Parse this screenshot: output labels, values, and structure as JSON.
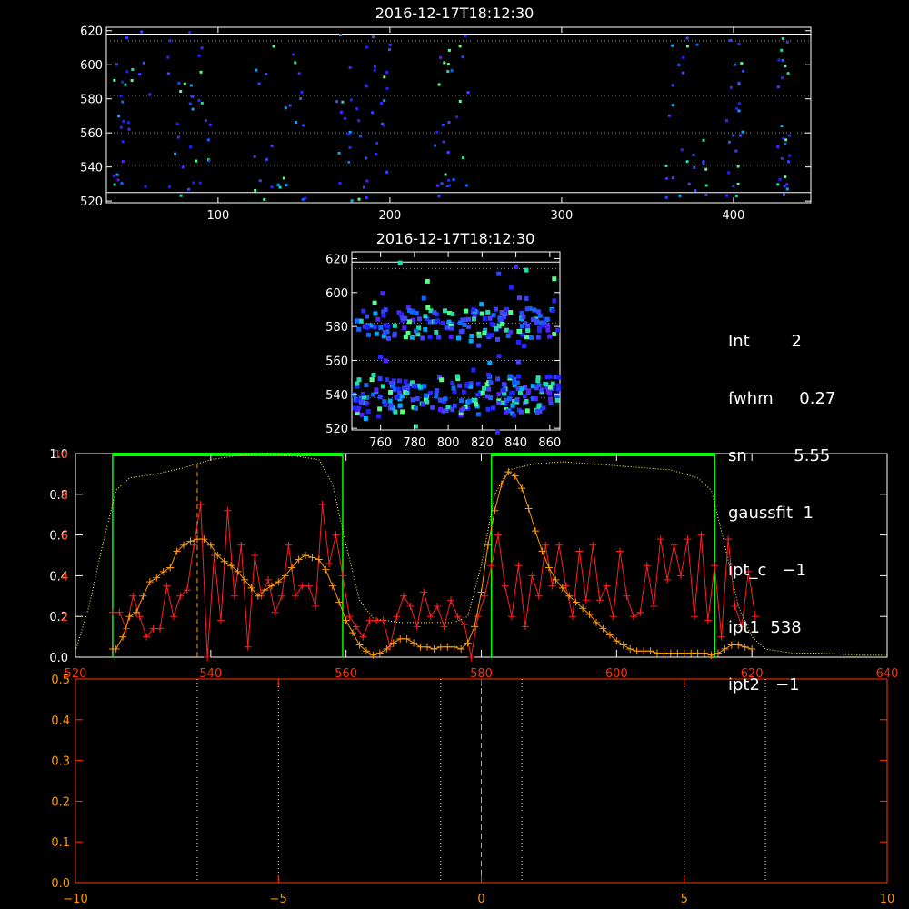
{
  "chart_data": [
    {
      "id": "top_image",
      "type": "heatmap",
      "title": "2016-12-17T18:12:30",
      "xlim": [
        35,
        445
      ],
      "ylim": [
        519,
        622
      ],
      "xticks": [
        100,
        200,
        300,
        400
      ],
      "yticks": [
        520,
        540,
        560,
        580,
        600,
        620
      ],
      "ref_lines_white": [
        525,
        618
      ],
      "ref_lines_green": [
        582,
        614,
        560
      ],
      "ref_lines_red": [
        541
      ],
      "columns": [
        [
          35,
          60
        ],
        [
          70,
          95
        ],
        [
          120,
          150
        ],
        [
          168,
          200
        ],
        [
          225,
          245
        ],
        [
          360,
          385
        ],
        [
          395,
          405
        ],
        [
          425,
          432
        ]
      ],
      "pixel_count": 230
    },
    {
      "id": "zoom_image",
      "type": "heatmap",
      "title": "2016-12-17T18:12:30",
      "xlim": [
        743,
        866
      ],
      "ylim": [
        519,
        624
      ],
      "xticks": [
        760,
        780,
        800,
        820,
        840,
        860
      ],
      "yticks": [
        520,
        540,
        560,
        580,
        600,
        620
      ],
      "ref_lines_white": [
        618
      ],
      "ref_lines_green": [
        614,
        582,
        560
      ],
      "ref_lines_red": [
        538
      ],
      "pixel_count": 420
    },
    {
      "id": "spectrum",
      "type": "line",
      "xlim": [
        520,
        640
      ],
      "ylim": [
        0,
        1.0
      ],
      "xticks": [
        520,
        540,
        560,
        580,
        600,
        620,
        640
      ],
      "yticks": [
        0.0,
        0.2,
        0.4,
        0.6,
        0.8,
        1.0
      ],
      "right_yticks": [
        2,
        4,
        6,
        8,
        10
      ],
      "windows": [
        [
          525.5,
          559.5
        ],
        [
          581.5,
          614.5
        ]
      ],
      "vline_orange": 538,
      "green_dotted": {
        "x": [
          520,
          522,
          524,
          526,
          528,
          532,
          536,
          540,
          544,
          548,
          552,
          556,
          558,
          560,
          562,
          564,
          568,
          572,
          576,
          578,
          580,
          582,
          584,
          588,
          592,
          596,
          600,
          604,
          608,
          612,
          614,
          616,
          618,
          620,
          622,
          626,
          630,
          636,
          640
        ],
        "y": [
          0.03,
          0.25,
          0.55,
          0.82,
          0.88,
          0.9,
          0.93,
          0.97,
          0.99,
          1.0,
          0.99,
          0.97,
          0.85,
          0.55,
          0.28,
          0.19,
          0.17,
          0.17,
          0.17,
          0.2,
          0.45,
          0.8,
          0.92,
          0.95,
          0.96,
          0.95,
          0.94,
          0.93,
          0.92,
          0.88,
          0.82,
          0.55,
          0.25,
          0.1,
          0.04,
          0.02,
          0.02,
          0.01,
          0.01
        ]
      },
      "orange_series": {
        "x": [
          525.5,
          526,
          527,
          528,
          529,
          530,
          531,
          532,
          533,
          534,
          535,
          536,
          537,
          538,
          539,
          540,
          541,
          542,
          543,
          544,
          545,
          546,
          547,
          548,
          549,
          550,
          551,
          552,
          553,
          554,
          555,
          556,
          557,
          558,
          559,
          560,
          561,
          562,
          563,
          564,
          565,
          566,
          567,
          568,
          569,
          570,
          571,
          572,
          573,
          574,
          575,
          576,
          577,
          578,
          579,
          580,
          581,
          582,
          583,
          584,
          585,
          586,
          587,
          588,
          589,
          590,
          591,
          592,
          593,
          594,
          595,
          596,
          597,
          598,
          599,
          600,
          601,
          602,
          603,
          604,
          605,
          606,
          607,
          608,
          609,
          610,
          611,
          612,
          613,
          614,
          615,
          616,
          617,
          618,
          619,
          620
        ],
        "y": [
          0.04,
          0.04,
          0.1,
          0.2,
          0.22,
          0.3,
          0.37,
          0.39,
          0.42,
          0.44,
          0.52,
          0.55,
          0.57,
          0.58,
          0.58,
          0.55,
          0.5,
          0.47,
          0.45,
          0.42,
          0.38,
          0.34,
          0.3,
          0.33,
          0.35,
          0.37,
          0.4,
          0.44,
          0.48,
          0.5,
          0.49,
          0.48,
          0.43,
          0.35,
          0.27,
          0.18,
          0.12,
          0.06,
          0.03,
          0.01,
          0.02,
          0.04,
          0.07,
          0.09,
          0.09,
          0.07,
          0.05,
          0.05,
          0.04,
          0.05,
          0.05,
          0.05,
          0.04,
          0.07,
          0.15,
          0.32,
          0.55,
          0.72,
          0.85,
          0.91,
          0.89,
          0.83,
          0.73,
          0.62,
          0.52,
          0.44,
          0.38,
          0.34,
          0.3,
          0.27,
          0.24,
          0.21,
          0.17,
          0.14,
          0.11,
          0.08,
          0.06,
          0.04,
          0.03,
          0.03,
          0.03,
          0.02,
          0.02,
          0.02,
          0.02,
          0.02,
          0.02,
          0.02,
          0.02,
          0.01,
          0.02,
          0.04,
          0.06,
          0.06,
          0.05,
          0.04
        ]
      },
      "red_series": {
        "x": [
          525.5,
          526.5,
          527.5,
          528.5,
          529.5,
          530.5,
          531.5,
          532.5,
          533.5,
          534.5,
          535.5,
          536.5,
          537.5,
          538.5,
          539.5,
          540.5,
          541.5,
          542.5,
          543.5,
          544.5,
          545.5,
          546.5,
          547.5,
          548.5,
          549.5,
          550.5,
          551.5,
          552.5,
          553.5,
          554.5,
          555.5,
          556.5,
          557.5,
          558.5,
          559.5,
          560.5,
          561.5,
          562.5,
          563.5,
          564.5,
          565.5,
          566.5,
          567.5,
          568.5,
          569.5,
          570.5,
          571.5,
          572.5,
          573.5,
          574.5,
          575.5,
          576.5,
          577.5,
          578.5,
          579.5,
          580.5,
          581.5,
          582.5,
          583.5,
          584.5,
          585.5,
          586.5,
          587.5,
          588.5,
          589.5,
          590.5,
          591.5,
          592.5,
          593.5,
          594.5,
          595.5,
          596.5,
          597.5,
          598.5,
          599.5,
          600.5,
          601.5,
          602.5,
          603.5,
          604.5,
          605.5,
          606.5,
          607.5,
          608.5,
          609.5,
          610.5,
          611.5,
          612.5,
          613.5,
          614.5,
          615.5,
          616.5,
          617.5,
          618.5,
          619.5,
          620.5
        ],
        "y": [
          0.22,
          0.22,
          0.14,
          0.3,
          0.2,
          0.1,
          0.14,
          0.14,
          0.35,
          0.2,
          0.3,
          0.33,
          0.55,
          0.75,
          0.0,
          0.5,
          0.18,
          0.72,
          0.3,
          0.55,
          0.05,
          0.5,
          0.3,
          0.38,
          0.22,
          0.3,
          0.55,
          0.3,
          0.35,
          0.35,
          0.25,
          0.75,
          0.46,
          0.6,
          0.4,
          0.2,
          0.15,
          0.1,
          0.18,
          0.18,
          0.18,
          0.05,
          0.2,
          0.3,
          0.25,
          0.15,
          0.32,
          0.2,
          0.25,
          0.15,
          0.28,
          0.2,
          0.16,
          0.0,
          0.2,
          0.3,
          0.45,
          0.6,
          0.35,
          0.2,
          0.45,
          0.15,
          0.4,
          0.3,
          0.55,
          0.35,
          0.55,
          0.35,
          0.2,
          0.52,
          0.28,
          0.55,
          0.28,
          0.35,
          0.2,
          0.52,
          0.3,
          0.2,
          0.22,
          0.45,
          0.25,
          0.58,
          0.38,
          0.55,
          0.4,
          0.58,
          0.2,
          0.6,
          0.18,
          0.45,
          0.1,
          0.58,
          0.25,
          0.15,
          0.42,
          0.2
        ]
      }
    },
    {
      "id": "bottom_plot",
      "type": "line",
      "xlim": [
        -10,
        10
      ],
      "ylim": [
        0,
        0.5
      ],
      "xticks": [
        -10,
        -5,
        0,
        5,
        10
      ],
      "yticks": [
        0.0,
        0.1,
        0.2,
        0.3,
        0.4,
        0.5
      ],
      "vlines_dotted_yellow": [
        -7,
        -1,
        1,
        7
      ],
      "vlines_dotted_green": [
        -5,
        5
      ],
      "vline_dashed_orange": 0
    }
  ],
  "stats": {
    "lines": [
      "Int        2",
      "fwhm     0.27",
      "sn         5.55",
      "gaussfit  1",
      "ipt_c   −1",
      "ipt1  538",
      "ipt2   −1"
    ]
  },
  "colors": {
    "axis": "#ffffff",
    "green": "#00ff00",
    "orange": "#ff9900",
    "red": "#ff2020",
    "lower_axis": "#ff3300",
    "lower_tick_labels": "#ff9900",
    "yellow": "#ffff66"
  }
}
